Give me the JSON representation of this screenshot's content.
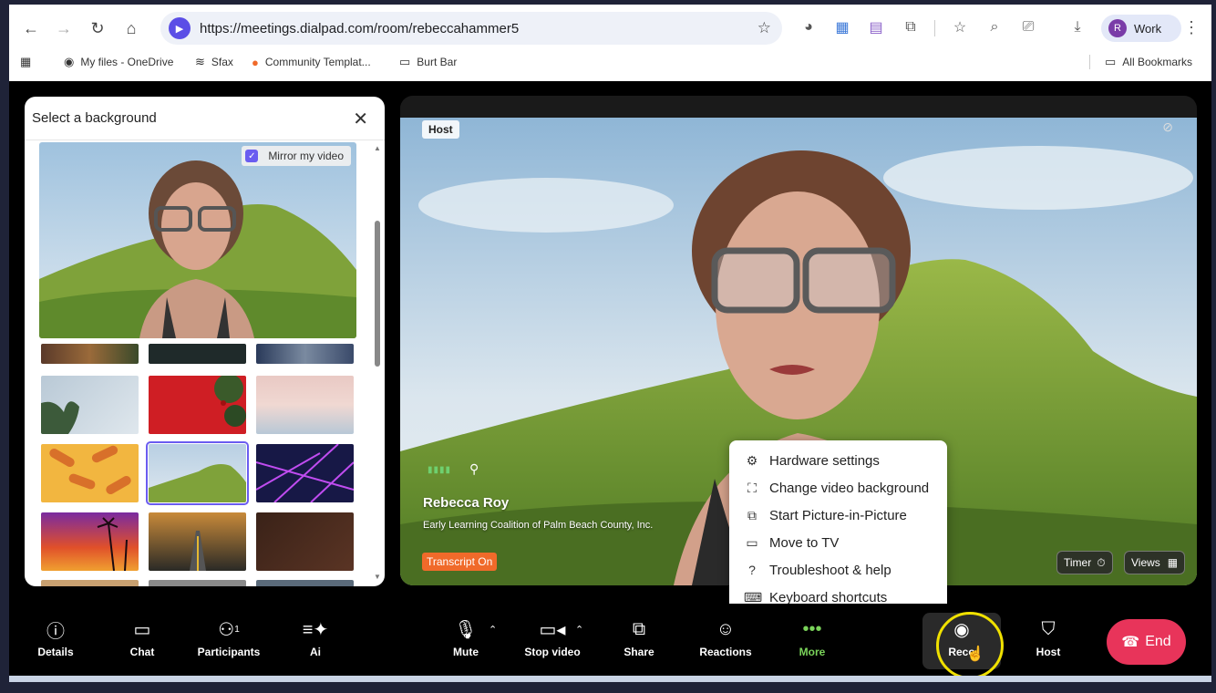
{
  "browser": {
    "url": "https://meetings.dialpad.com/room/rebeccahammer5",
    "profile_initial": "R",
    "profile_label": "Work",
    "bookmarks": [
      {
        "label": "My files - OneDrive",
        "icon": "onedrive-icon"
      },
      {
        "label": "Sfax",
        "icon": "sfax-icon"
      },
      {
        "label": "Community Templat...",
        "icon": "community-icon"
      },
      {
        "label": "Burt Bar",
        "icon": "folder-icon"
      }
    ],
    "all_bookmarks": "All Bookmarks"
  },
  "bg_panel": {
    "title": "Select a background",
    "mirror_label": "Mirror my video",
    "mirror_checked": true,
    "selected_index": 4
  },
  "video": {
    "host_badge": "Host",
    "participant_name": "Rebecca Roy",
    "organization": "Early Learning Coalition of Palm Beach County, Inc.",
    "transcript": "Transcript On",
    "timer_label": "Timer",
    "views_label": "Views"
  },
  "more_menu": {
    "items": [
      {
        "label": "Hardware settings",
        "icon": "gear-icon"
      },
      {
        "label": "Change video background",
        "icon": "background-icon"
      },
      {
        "label": "Start Picture-in-Picture",
        "icon": "pip-icon"
      },
      {
        "label": "Move to TV",
        "icon": "tv-icon"
      },
      {
        "label": "Troubleshoot & help",
        "icon": "help-icon"
      },
      {
        "label": "Keyboard shortcuts",
        "icon": "keyboard-icon"
      }
    ]
  },
  "toolbar": {
    "details": "Details",
    "chat": "Chat",
    "participants": "Participants",
    "participants_count": "1",
    "ai": "Ai",
    "mute": "Mute",
    "stop_video": "Stop video",
    "share": "Share",
    "reactions": "Reactions",
    "more": "More",
    "record": "Reco",
    "host": "Host",
    "end": "End"
  },
  "colors": {
    "accent": "#6a5cf0",
    "more_active": "#7ad35a",
    "end": "#e8345a",
    "transcript": "#f06a2a",
    "cursor_ring": "#f0e100"
  }
}
